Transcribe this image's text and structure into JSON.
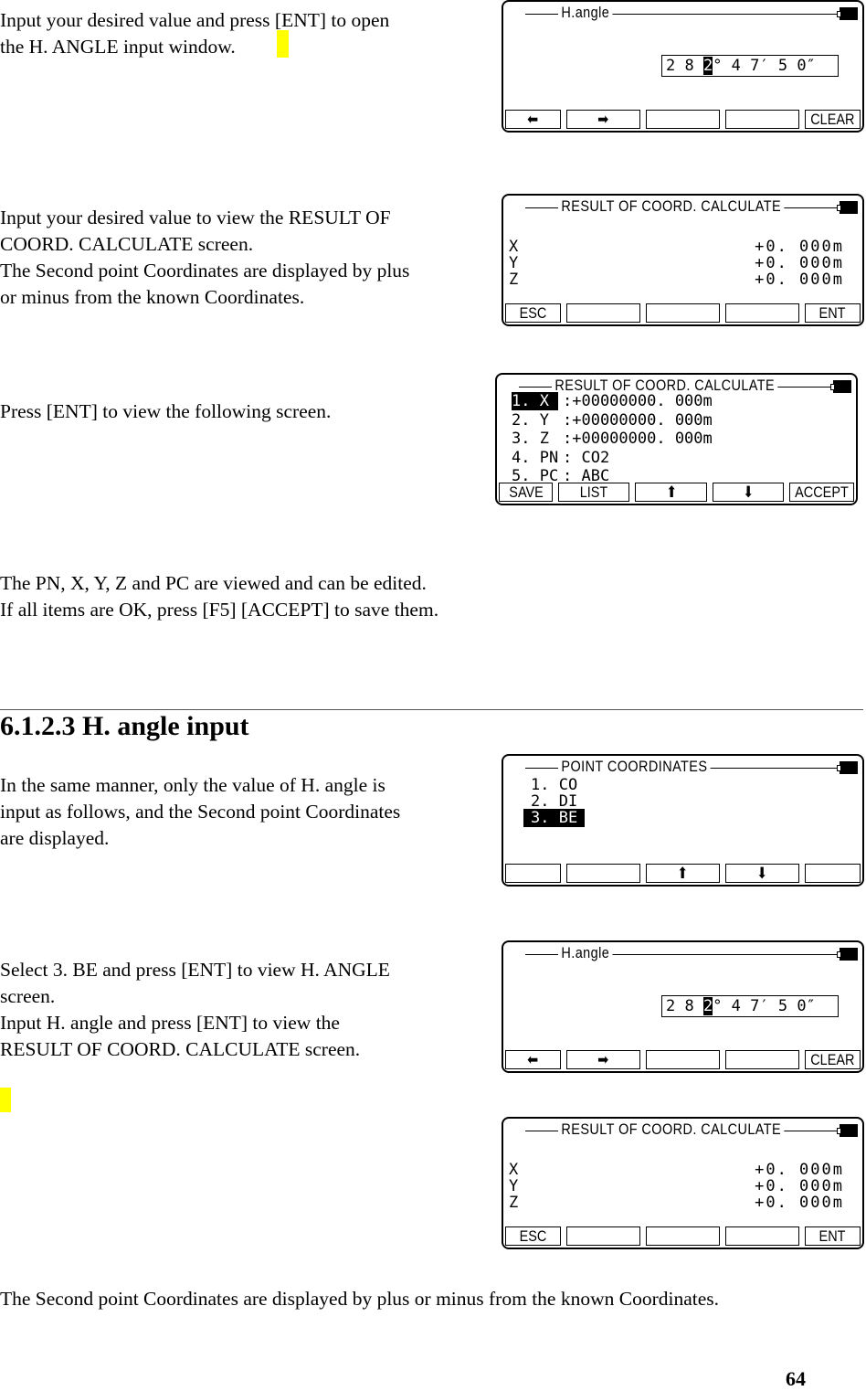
{
  "text": {
    "p1": "Input your desired value and press [ENT] to open\nthe H. ANGLE input window.",
    "p2": "Input your desired value to view the RESULT OF\nCOORD. CALCULATE screen.\nThe Second point Coordinates are displayed by plus\nor minus from the known Coordinates.",
    "p3": "Press [ENT] to view the following screen.",
    "p4": "The PN, X, Y, Z and PC are viewed and can be edited.\nIf all items are OK, press [F5] [ACCEPT] to save them.",
    "heading": "6.1.2.3 H. angle input",
    "p5": "In the same manner, only the value of H. angle is\ninput as follows, and the Second point Coordinates\nare displayed.",
    "p6": "Select 3. BE and press [ENT] to view H. ANGLE\nscreen.\nInput H. angle and press [ENT] to view the\nRESULT OF COORD. CALCULATE screen.",
    "p7": "The Second point Coordinates are displayed by plus or minus from the known Coordinates.",
    "page_number": "64"
  },
  "highlight_color": "#ffff00",
  "screens": [
    {
      "title": "H.angle",
      "type": "angle",
      "value_pre": "2 8 ",
      "value_cursor": "2",
      "value_post": "° 4 7′ 5 0″",
      "keys": [
        {
          "icon": "arrow-left-icon",
          "label": "⬅"
        },
        {
          "icon": "arrow-right-icon",
          "label": "➡"
        },
        {
          "label": ""
        },
        {
          "label": ""
        },
        {
          "label": "CLEAR"
        }
      ]
    },
    {
      "title": "RESULT OF COORD. CALCULATE",
      "type": "xyz",
      "rows": [
        {
          "label": "X",
          "value": "+0. 000m"
        },
        {
          "label": "Y",
          "value": "+0. 000m"
        },
        {
          "label": "Z",
          "value": "+0. 000m"
        }
      ],
      "keys": [
        {
          "label": "ESC"
        },
        {
          "label": ""
        },
        {
          "label": ""
        },
        {
          "label": ""
        },
        {
          "label": "ENT"
        }
      ]
    },
    {
      "title": "RESULT OF COORD. CALCULATE",
      "type": "list",
      "rows": [
        {
          "label": "1. X ",
          "value": ":+00000000. 000m",
          "selected": true
        },
        {
          "label": "2. Y ",
          "value": ":+00000000. 000m"
        },
        {
          "label": "3. Z ",
          "value": ":+00000000. 000m"
        },
        {
          "label": "4. PN",
          "value": ": CO2"
        },
        {
          "label": "5. PC",
          "value": ": ABC"
        }
      ],
      "keys": [
        {
          "label": "SAVE"
        },
        {
          "label": "LIST"
        },
        {
          "icon": "arrow-up-icon",
          "label": "⬆"
        },
        {
          "icon": "arrow-down-icon",
          "label": "⬇"
        },
        {
          "label": "ACCEPT"
        }
      ]
    },
    {
      "title": "POINT COORDINATES",
      "type": "menu",
      "rows": [
        {
          "label": "1. CO"
        },
        {
          "label": "2. DI"
        },
        {
          "label": "3. BE",
          "selected": true
        }
      ],
      "keys": [
        {
          "label": ""
        },
        {
          "label": ""
        },
        {
          "icon": "arrow-up-icon",
          "label": "⬆"
        },
        {
          "icon": "arrow-down-icon",
          "label": "⬇"
        },
        {
          "label": ""
        }
      ]
    },
    {
      "title": "H.angle",
      "type": "angle",
      "value_pre": "2 8 ",
      "value_cursor": "2",
      "value_post": "° 4 7′ 5 0″",
      "keys": [
        {
          "icon": "arrow-left-icon",
          "label": "⬅"
        },
        {
          "icon": "arrow-right-icon",
          "label": "➡"
        },
        {
          "label": ""
        },
        {
          "label": ""
        },
        {
          "label": "CLEAR"
        }
      ]
    },
    {
      "title": "RESULT OF COORD. CALCULATE",
      "type": "xyz",
      "rows": [
        {
          "label": "X",
          "value": "+0. 000m"
        },
        {
          "label": "Y",
          "value": "+0. 000m"
        },
        {
          "label": "Z",
          "value": "+0. 000m"
        }
      ],
      "keys": [
        {
          "label": "ESC"
        },
        {
          "label": ""
        },
        {
          "label": ""
        },
        {
          "label": ""
        },
        {
          "label": "ENT"
        }
      ]
    }
  ]
}
